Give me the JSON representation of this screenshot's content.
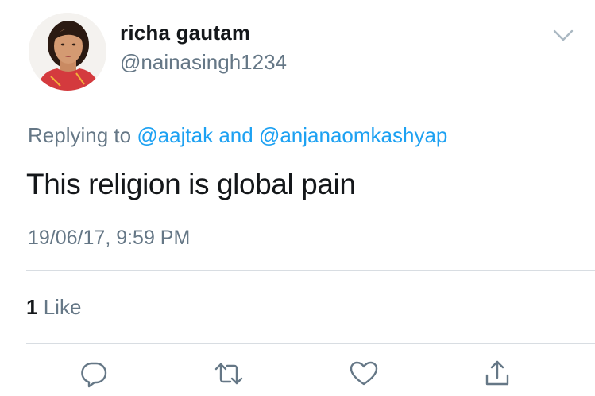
{
  "author": {
    "display_name": "richa gautam",
    "handle": "@nainasingh1234"
  },
  "reply_context": {
    "prefix": "Replying to",
    "mention_1": "@aajtak",
    "conjunction": "and",
    "mention_2": "@anjanaomkashyap"
  },
  "tweet": {
    "text": "This religion is global pain",
    "timestamp": "19/06/17, 9:59 PM"
  },
  "stats": {
    "like_count": "1",
    "like_label": "Like"
  },
  "icons": {
    "menu": "chevron-down-icon",
    "reply": "reply-icon",
    "retweet": "retweet-icon",
    "like": "heart-icon",
    "share": "share-icon"
  },
  "colors": {
    "mention_blue": "#1da1f2",
    "secondary_gray": "#657786",
    "primary_text": "#14171a",
    "icon_gray": "#657786",
    "divider": "#d8dde2"
  }
}
